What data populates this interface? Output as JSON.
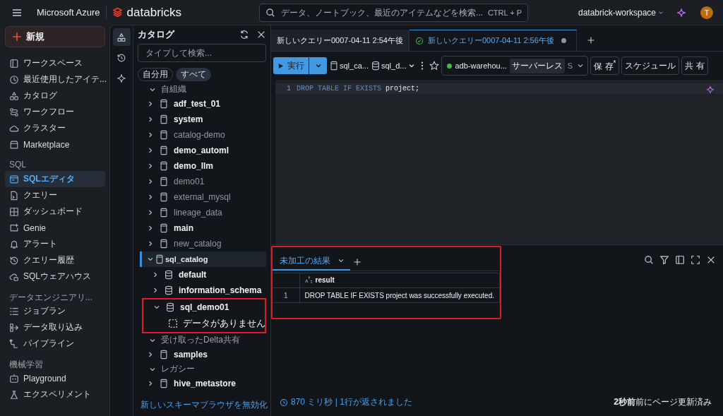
{
  "topbar": {
    "brand": "Microsoft Azure",
    "product": "databricks",
    "search": {
      "placeholder": "データ、ノートブック、最近のアイテムなどを検索...",
      "shortcut": "CTRL + P"
    },
    "workspace": "databrick-workspace",
    "avatar": "T"
  },
  "sidebar": {
    "new_button": "新規",
    "items": [
      {
        "kind": "item",
        "label": "ワークスペース",
        "selected": false
      },
      {
        "kind": "item",
        "label": "最近使用したアイテ...",
        "selected": false
      },
      {
        "kind": "item",
        "label": "カタログ",
        "selected": false
      },
      {
        "kind": "item",
        "label": "ワークフロー",
        "selected": false
      },
      {
        "kind": "item",
        "label": "クラスター",
        "selected": false
      },
      {
        "kind": "item",
        "label": "Marketplace",
        "selected": false
      },
      {
        "kind": "header",
        "label": "SQL"
      },
      {
        "kind": "item",
        "label": "SQLエディタ",
        "selected": true
      },
      {
        "kind": "item",
        "label": "クエリー",
        "selected": false
      },
      {
        "kind": "item",
        "label": "ダッシュボード",
        "selected": false
      },
      {
        "kind": "item",
        "label": "Genie",
        "selected": false
      },
      {
        "kind": "item",
        "label": "アラート",
        "selected": false
      },
      {
        "kind": "item",
        "label": "クエリー履歴",
        "selected": false
      },
      {
        "kind": "item",
        "label": "SQLウェアハウス",
        "selected": false
      },
      {
        "kind": "header",
        "label": "データエンジニアリ..."
      },
      {
        "kind": "item",
        "label": "ジョブラン",
        "selected": false
      },
      {
        "kind": "item",
        "label": "データ取り込み",
        "selected": false
      },
      {
        "kind": "item",
        "label": "パイプライン",
        "selected": false
      },
      {
        "kind": "header",
        "label": "機械学習"
      },
      {
        "kind": "item",
        "label": "Playground",
        "selected": false
      },
      {
        "kind": "item",
        "label": "エクスペリメント",
        "selected": false
      }
    ]
  },
  "catalog": {
    "rail": [
      {
        "selected": true
      },
      {
        "selected": false
      },
      {
        "selected": false
      }
    ],
    "title": "カタログ",
    "search": {
      "placeholder": "タイプして検索..."
    },
    "filters": [
      {
        "label": "自分用",
        "selected": false
      },
      {
        "label": "すべて",
        "selected": true
      }
    ],
    "tree": [
      {
        "kind": "section",
        "label": "自組織",
        "expanded": true,
        "selected": false,
        "children": [
          {
            "kind": "catalog",
            "label": "adf_test_01",
            "expanded": false,
            "muted": false,
            "selected": false
          },
          {
            "kind": "catalog",
            "label": "system",
            "expanded": false,
            "muted": false,
            "selected": false
          },
          {
            "kind": "catalog",
            "label": "catalog-demo",
            "expanded": false,
            "muted": true,
            "selected": false
          },
          {
            "kind": "catalog",
            "label": "demo_automl",
            "expanded": false,
            "muted": false,
            "selected": false
          },
          {
            "kind": "catalog",
            "label": "demo_llm",
            "expanded": false,
            "muted": false,
            "selected": false
          },
          {
            "kind": "catalog",
            "label": "demo01",
            "expanded": false,
            "muted": true,
            "selected": false
          },
          {
            "kind": "catalog",
            "label": "external_mysql",
            "expanded": false,
            "muted": true,
            "selected": false
          },
          {
            "kind": "catalog",
            "label": "lineage_data",
            "expanded": false,
            "muted": true,
            "selected": false
          },
          {
            "kind": "catalog",
            "label": "main",
            "expanded": false,
            "muted": false,
            "selected": false
          },
          {
            "kind": "catalog",
            "label": "new_catalog",
            "expanded": false,
            "muted": true,
            "selected": false
          },
          {
            "kind": "catalog",
            "label": "sql_catalog",
            "expanded": true,
            "muted": false,
            "selected": true,
            "children": [
              {
                "kind": "schema",
                "label": "default",
                "expanded": false,
                "muted": false,
                "selected": false
              },
              {
                "kind": "schema",
                "label": "information_schema",
                "expanded": false,
                "muted": false,
                "selected": false
              },
              {
                "kind": "schema",
                "label": "sql_demo01",
                "expanded": true,
                "muted": false,
                "selected": false,
                "highlighted": true,
                "children": [
                  {
                    "kind": "empty",
                    "label": "データがありません"
                  }
                ]
              }
            ]
          }
        ]
      },
      {
        "kind": "section",
        "label": "受け取ったDelta共有",
        "expanded": true,
        "selected": false,
        "children": [
          {
            "kind": "catalog",
            "label": "samples",
            "expanded": false,
            "muted": false,
            "selected": false
          }
        ]
      },
      {
        "kind": "section",
        "label": "レガシー",
        "expanded": true,
        "selected": false,
        "children": [
          {
            "kind": "catalog",
            "label": "hive_metastore",
            "expanded": false,
            "muted": false,
            "selected": false
          }
        ]
      }
    ],
    "footer_link": "新しいスキーマブラウザを無効化"
  },
  "editor": {
    "tabs": [
      {
        "label": "新しいクエリー0007-04-11 2:54午後",
        "selected": false,
        "unsaved": false
      },
      {
        "label": "新しいクエリー0007-04-11 2:56午後",
        "selected": true,
        "unsaved": true
      }
    ],
    "run_button": "実行",
    "catalog": "sql_ca...",
    "schema": "sql_d...",
    "warehouse": {
      "name": "adb-warehou...",
      "badge": "サーバーレス",
      "size": "S"
    },
    "buttons": [
      "保 存$^{*}$",
      "スケジュール",
      "共 有"
    ],
    "code_lines": [
      {
        "number": "1",
        "tokens": [
          {
            "kind": "keyword",
            "text": "DROP TABLE IF EXISTS"
          },
          {
            "kind": "plain",
            "text": "project;"
          }
        ]
      }
    ]
  },
  "results": {
    "highlighted": true,
    "tabs": [
      {
        "label": "未加工の結果",
        "selected": true
      }
    ],
    "columns": [
      "result"
    ],
    "rows": [
      {
        "index": "1",
        "cells": [
          "DROP TABLE IF EXISTS project was successfully executed."
        ]
      }
    ],
    "status": "870 ミリ秒 | 1行が返されました",
    "refreshed": "**2秒前**前にページ更新済み"
  }
}
